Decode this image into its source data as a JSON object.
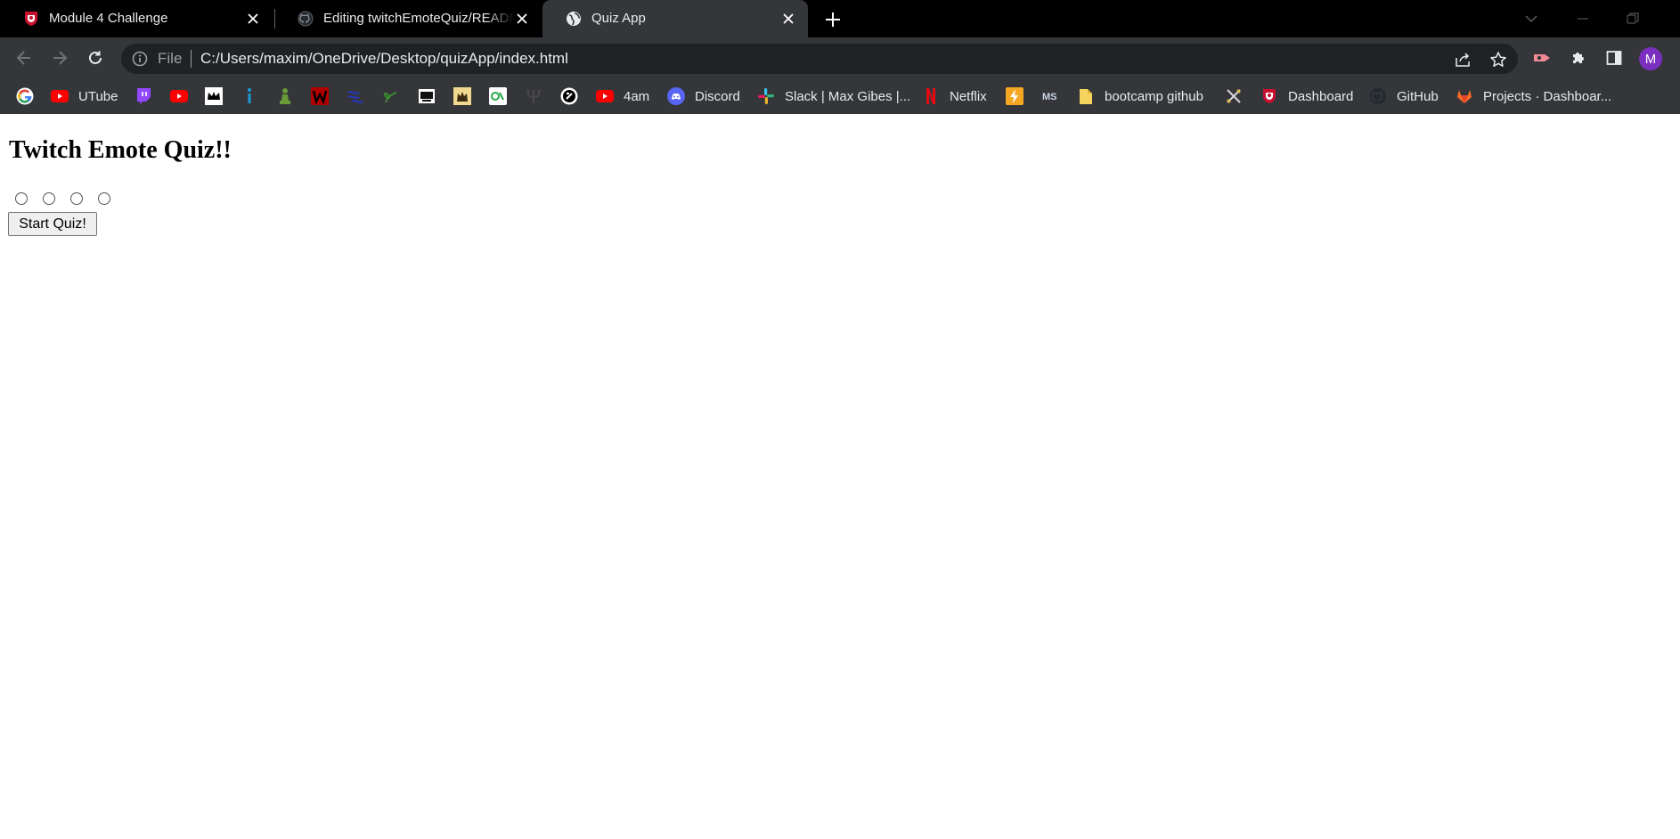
{
  "tabs": [
    {
      "title": "Module 4 Challenge",
      "favicon": "shield-crest-icon",
      "active": false
    },
    {
      "title": "Editing twitchEmoteQuiz/README.md",
      "favicon": "github-icon",
      "active": false
    },
    {
      "title": "Quiz App",
      "favicon": "globe-icon",
      "active": true
    }
  ],
  "omnibox": {
    "scheme_label": "File",
    "url": "C:/Users/maxim/OneDrive/Desktop/quizApp/index.html"
  },
  "profile": {
    "initial": "M",
    "color": "#7b2fbe"
  },
  "bookmarks": [
    {
      "label": "",
      "icon": "google-icon"
    },
    {
      "label": "UTube",
      "icon": "youtube-icon"
    },
    {
      "label": "",
      "icon": "twitch-icon"
    },
    {
      "label": "",
      "icon": "youtube-icon"
    },
    {
      "label": "",
      "icon": "crown-icon"
    },
    {
      "label": "",
      "icon": "info-icon"
    },
    {
      "label": "",
      "icon": "chess-pawn-icon"
    },
    {
      "label": "",
      "icon": "marvel-icon"
    },
    {
      "label": "",
      "icon": "blue-wave-icon"
    },
    {
      "label": "",
      "icon": "sprout-icon"
    },
    {
      "label": "",
      "icon": "terminal-icon"
    },
    {
      "label": "",
      "icon": "king-icon"
    },
    {
      "label": "",
      "icon": "green-badge-icon"
    },
    {
      "label": "",
      "icon": "trident-icon"
    },
    {
      "label": "",
      "icon": "circle-logo-icon"
    },
    {
      "label": "4am",
      "icon": "youtube-icon"
    },
    {
      "label": "Discord",
      "icon": "discord-icon"
    },
    {
      "label": "Slack | Max Gibes |...",
      "icon": "slack-icon"
    },
    {
      "label": "Netflix",
      "icon": "netflix-icon"
    },
    {
      "label": "",
      "icon": "lightning-icon"
    },
    {
      "label": "",
      "icon": "ms-icon"
    },
    {
      "label": "bootcamp github",
      "icon": "folder-icon"
    },
    {
      "label": "",
      "icon": "swords-icon"
    },
    {
      "label": "Dashboard",
      "icon": "shield-crest-icon"
    },
    {
      "label": "GitHub",
      "icon": "github-icon"
    },
    {
      "label": "Projects · Dashboar...",
      "icon": "gitlab-icon"
    }
  ],
  "page": {
    "title": "Twitch Emote Quiz!!",
    "radio_count": 4,
    "start_button": "Start Quiz!"
  },
  "colors": {
    "tabstrip": "#000000",
    "toolbar": "#35363a",
    "omnibox": "#202124",
    "text_light": "#e8eaed"
  }
}
